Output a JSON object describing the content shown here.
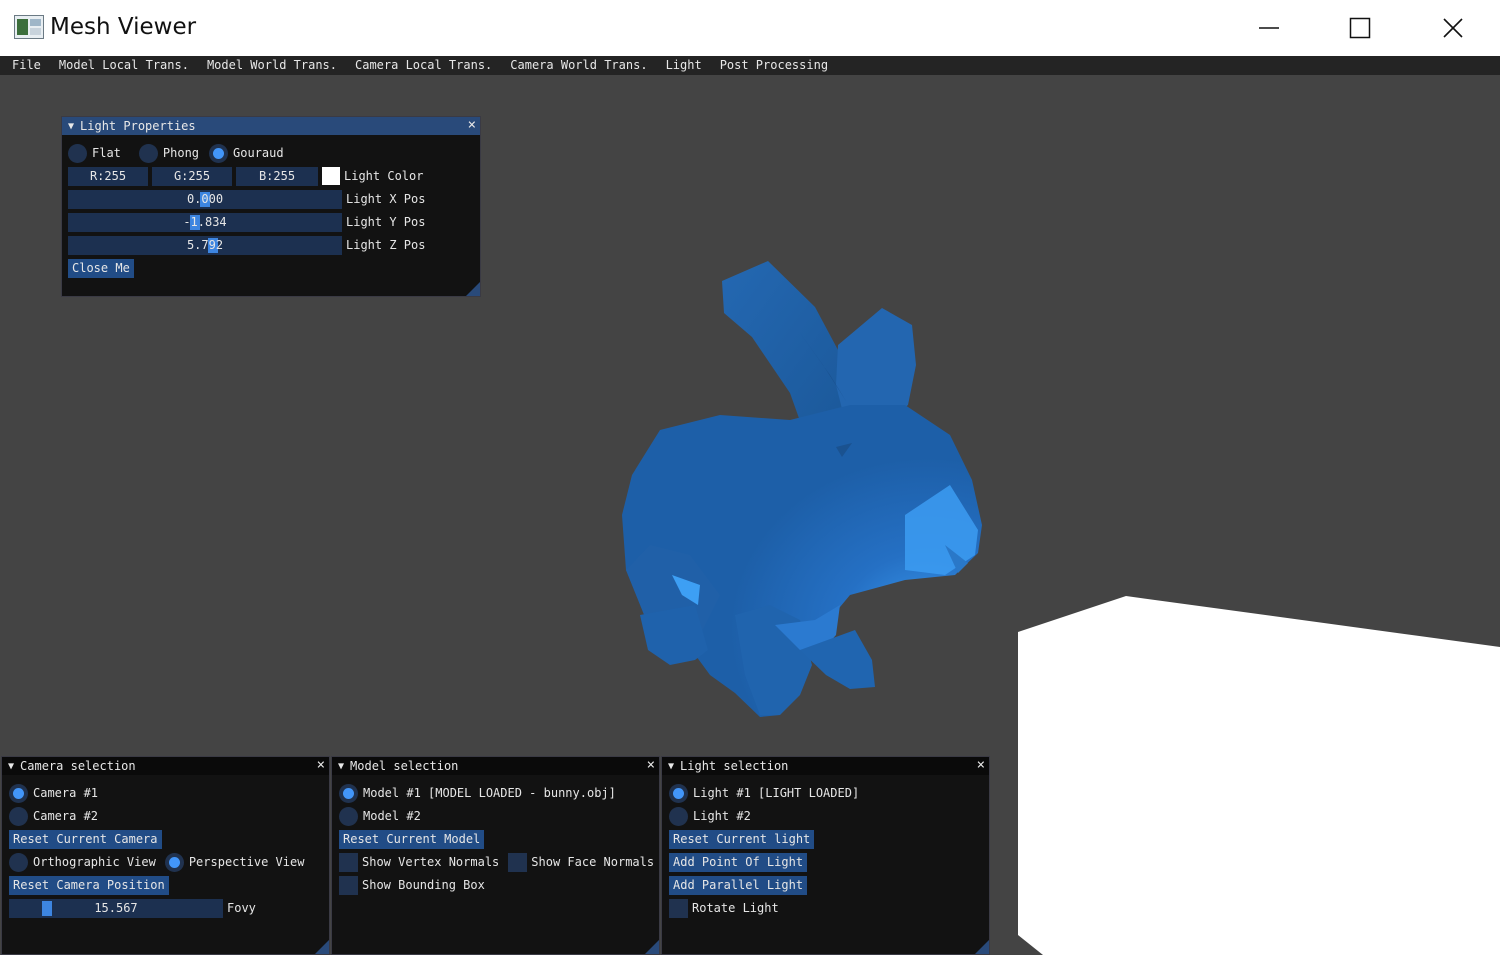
{
  "window": {
    "title": "Mesh Viewer"
  },
  "menubar": {
    "items": [
      "File",
      "Model Local Trans.",
      "Model World Trans.",
      "Camera Local Trans.",
      "Camera World Trans.",
      "Light",
      "Post Processing"
    ]
  },
  "light_properties": {
    "title": "Light Properties",
    "shading": {
      "flat": "Flat",
      "phong": "Phong",
      "gouraud": "Gouraud",
      "selected": "Gouraud"
    },
    "color": {
      "r": "R:255",
      "g": "G:255",
      "b": "B:255",
      "label": "Light Color",
      "value": "#ffffff"
    },
    "x_pos": {
      "value": "0.000",
      "label": "Light X Pos"
    },
    "y_pos": {
      "value": "-1.834",
      "label": "Light Y Pos"
    },
    "z_pos": {
      "value": "5.792",
      "label": "Light Z Pos"
    },
    "close_button": "Close Me"
  },
  "camera_selection": {
    "title": "Camera selection",
    "cameras": [
      "Camera #1",
      "Camera #2"
    ],
    "selected_camera": "Camera #1",
    "reset_camera": "Reset Current Camera",
    "orthographic": "Orthographic View",
    "perspective": "Perspective View",
    "selected_view": "Perspective View",
    "reset_position": "Reset Camera Position",
    "fovy": {
      "value": "15.567",
      "label": "Fovy"
    }
  },
  "model_selection": {
    "title": "Model selection",
    "models": [
      "Model #1 [MODEL LOADED - bunny.obj]",
      "Model #2"
    ],
    "selected_model": "Model #1 [MODEL LOADED - bunny.obj]",
    "reset_model": "Reset Current Model",
    "show_vertex_normals": "Show Vertex Normals",
    "show_face_normals": "Show Face Normals",
    "show_bounding_box": "Show Bounding Box"
  },
  "light_selection": {
    "title": "Light selection",
    "lights": [
      "Light #1 [LIGHT LOADED]",
      "Light #2"
    ],
    "selected_light": "Light #1 [LIGHT LOADED]",
    "reset_light": "Reset Current light",
    "add_point": "Add Point Of Light",
    "add_parallel": "Add Parallel Light",
    "rotate_light": "Rotate Light"
  },
  "colors": {
    "viewport_bg": "#444444",
    "model_color": "#1e64b4",
    "accent": "#4296fa",
    "button": "#214c86"
  }
}
